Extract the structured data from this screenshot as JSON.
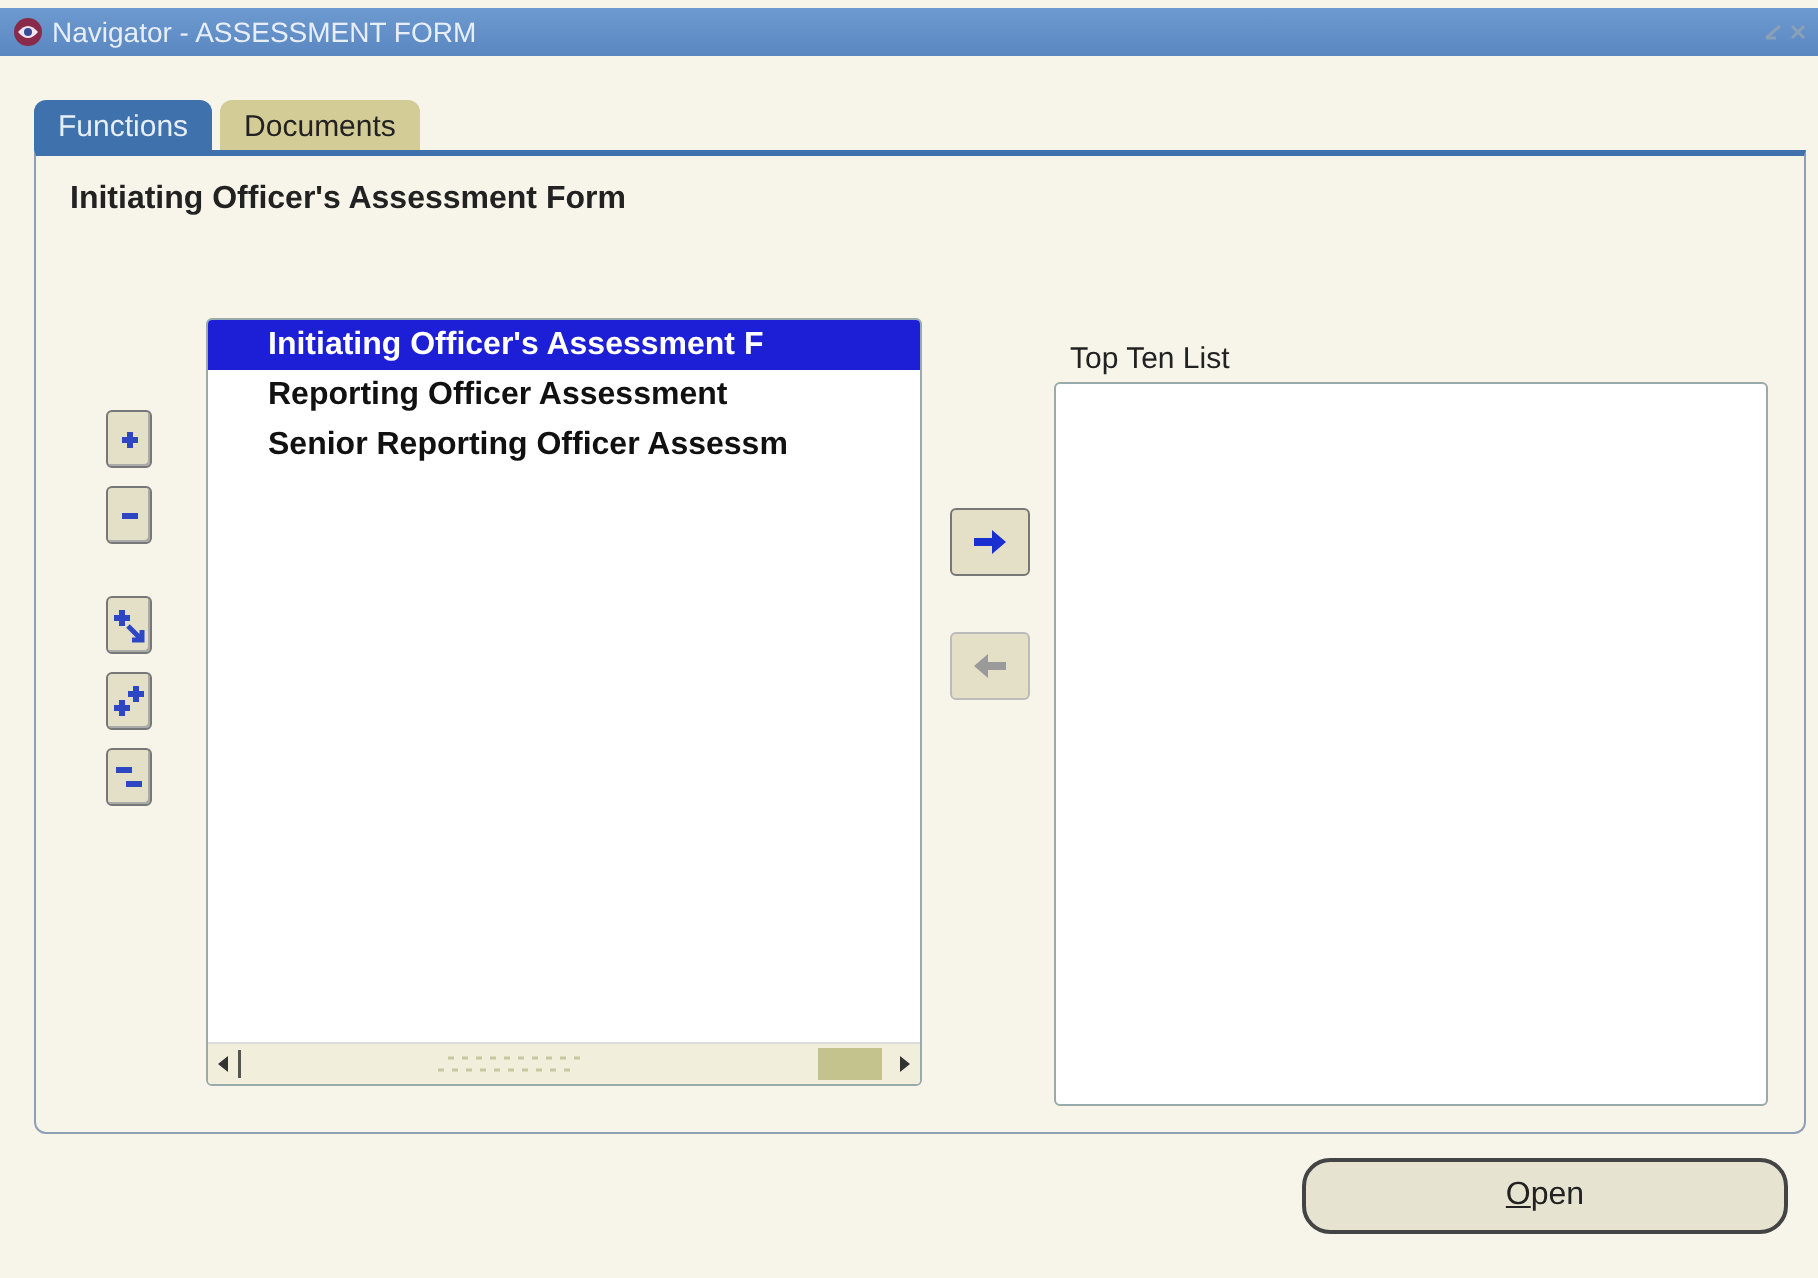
{
  "window": {
    "title": "Navigator - ASSESSMENT FORM"
  },
  "tabs": [
    {
      "label": "Functions",
      "selected": true
    },
    {
      "label": "Documents",
      "selected": false
    }
  ],
  "heading": "Initiating Officer's Assessment Form",
  "functions_list": {
    "items": [
      {
        "label": "Initiating Officer's Assessment F",
        "selected": true
      },
      {
        "label": "Reporting Officer Assessment",
        "selected": false
      },
      {
        "label": "Senior Reporting Officer Assessm",
        "selected": false
      }
    ]
  },
  "tree_buttons": [
    {
      "kind": "expand",
      "disabled": false
    },
    {
      "kind": "collapse",
      "disabled": false
    },
    {
      "kind": "expand-branch",
      "disabled": false
    },
    {
      "kind": "expand-all",
      "disabled": false
    },
    {
      "kind": "collapse-all",
      "disabled": false
    }
  ],
  "move_buttons": [
    {
      "kind": "add",
      "disabled": false
    },
    {
      "kind": "remove",
      "disabled": true
    }
  ],
  "top_ten": {
    "label": "Top Ten List"
  },
  "open_button": {
    "label": "Open"
  }
}
